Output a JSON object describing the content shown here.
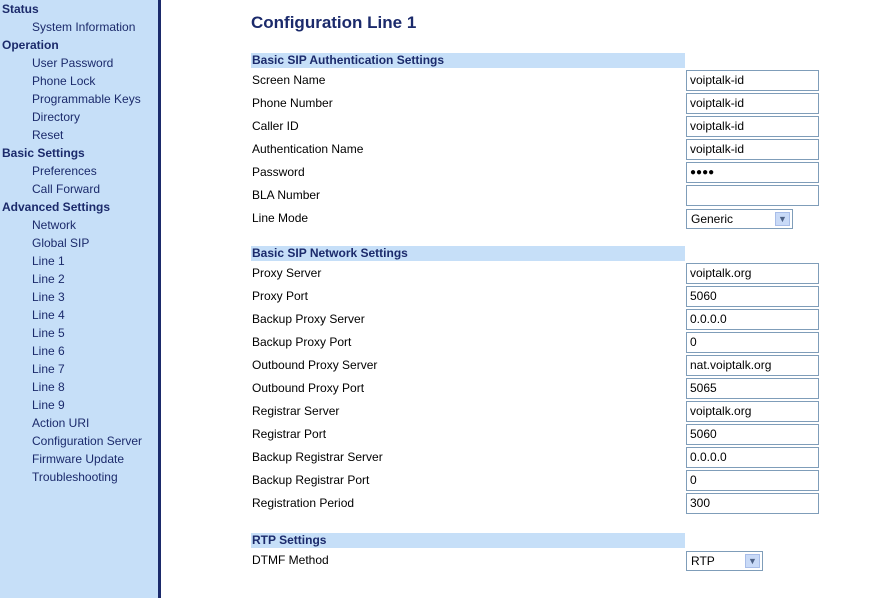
{
  "sidebar": {
    "sections": [
      {
        "label": "Status",
        "items": [
          "System Information"
        ]
      },
      {
        "label": "Operation",
        "items": [
          "User Password",
          "Phone Lock",
          "Programmable Keys",
          "Directory",
          "Reset"
        ]
      },
      {
        "label": "Basic Settings",
        "items": [
          "Preferences",
          "Call Forward"
        ]
      },
      {
        "label": "Advanced Settings",
        "items": [
          "Network",
          "Global SIP",
          "Line 1",
          "Line 2",
          "Line 3",
          "Line 4",
          "Line 5",
          "Line 6",
          "Line 7",
          "Line 8",
          "Line 9",
          "Action URI",
          "Configuration Server",
          "Firmware Update",
          "Troubleshooting"
        ]
      }
    ]
  },
  "title": "Configuration Line 1",
  "groups": [
    {
      "title": "Basic SIP Authentication Settings",
      "rows": [
        {
          "label": "Screen Name",
          "value": "voiptalk-id",
          "type": "text"
        },
        {
          "label": "Phone Number",
          "value": "voiptalk-id",
          "type": "text"
        },
        {
          "label": "Caller ID",
          "value": "voiptalk-id",
          "type": "text"
        },
        {
          "label": "Authentication Name",
          "value": "voiptalk-id",
          "type": "text"
        },
        {
          "label": "Password",
          "value": "●●●●",
          "type": "password"
        },
        {
          "label": "BLA Number",
          "value": "",
          "type": "text"
        },
        {
          "label": "Line Mode",
          "value": "Generic",
          "type": "select"
        }
      ]
    },
    {
      "title": "Basic SIP Network Settings",
      "rows": [
        {
          "label": "Proxy Server",
          "value": "voiptalk.org",
          "type": "text"
        },
        {
          "label": "Proxy Port",
          "value": "5060",
          "type": "text"
        },
        {
          "label": "Backup Proxy Server",
          "value": "0.0.0.0",
          "type": "text"
        },
        {
          "label": "Backup Proxy Port",
          "value": "0",
          "type": "text"
        },
        {
          "label": "Outbound Proxy Server",
          "value": "nat.voiptalk.org",
          "type": "text"
        },
        {
          "label": "Outbound Proxy Port",
          "value": "5065",
          "type": "text"
        },
        {
          "label": "Registrar Server",
          "value": "voiptalk.org",
          "type": "text"
        },
        {
          "label": "Registrar Port",
          "value": "5060",
          "type": "text"
        },
        {
          "label": "Backup Registrar Server",
          "value": "0.0.0.0",
          "type": "text"
        },
        {
          "label": "Backup Registrar Port",
          "value": "0",
          "type": "text"
        },
        {
          "label": "Registration Period",
          "value": "300",
          "type": "text"
        }
      ]
    },
    {
      "title": "RTP Settings",
      "rows": [
        {
          "label": "DTMF Method",
          "value": "RTP",
          "type": "select"
        }
      ]
    }
  ],
  "colors": {
    "sidebar_bg": "#c6dff8",
    "navy": "#1b2a6b"
  }
}
